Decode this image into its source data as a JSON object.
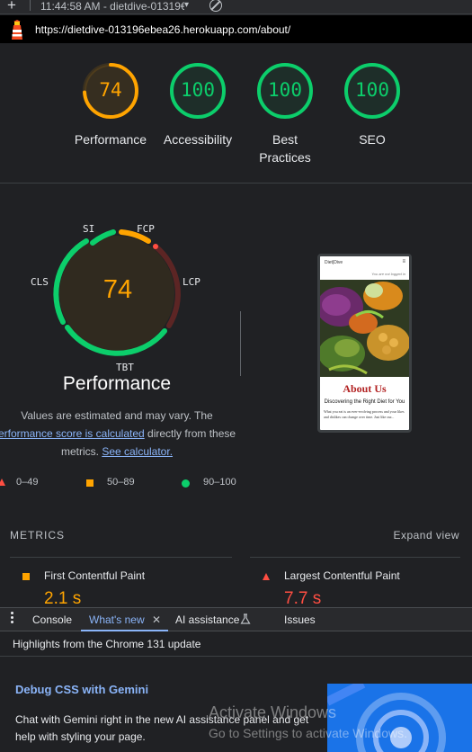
{
  "toolbar": {
    "time_text": "11:44:58 AM - dietdive-01319€",
    "dropdown_glyph": "▾",
    "plus_glyph": "+"
  },
  "urlbar": {
    "url": "https://dietdive-013196ebea26.herokuapp.com/about/"
  },
  "scores": [
    {
      "label": "Performance",
      "value": "74",
      "color": "#ffa400",
      "fraction": 0.74
    },
    {
      "label": "Accessibility",
      "value": "100",
      "color": "#0cce6b",
      "fraction": 1.0
    },
    {
      "label": "Best Practices",
      "value": "100",
      "color": "#0cce6b",
      "fraction": 1.0
    },
    {
      "label": "SEO",
      "value": "100",
      "color": "#0cce6b",
      "fraction": 1.0
    }
  ],
  "performance": {
    "score": "74",
    "title": "Performance",
    "metric_labels": {
      "si": "SI",
      "fcp": "FCP",
      "lcp": "LCP",
      "tbt": "TBT",
      "cls": "CLS"
    },
    "note_line1": "Values are estimated and may vary. The",
    "note_link1": "erformance score is calculated",
    "note_line2_rest": " directly from these",
    "note_line3_pre": "metrics. ",
    "note_link2": "See calculator."
  },
  "legend": {
    "fail": "0–49",
    "average": "50–89",
    "pass": "90–100"
  },
  "phone_preview": {
    "brand": "Diet|Dive",
    "menu_glyph": "≡",
    "tagline": "You are not logged in",
    "heading": "About Us",
    "subheading": "Discovering the Right Diet for You",
    "body": "What you eat is an ever-evolving process and your likes and dislikes can change over time. Just like our..."
  },
  "metrics": {
    "header": "METRICS",
    "expand": "Expand view",
    "items": [
      {
        "label": "First Contentful Paint",
        "value": "2.1 s",
        "status": "average",
        "color": "#ffa400"
      },
      {
        "label": "Largest Contentful Paint",
        "value": "7.7 s",
        "status": "fail",
        "color": "#ff4e42"
      }
    ]
  },
  "drawer": {
    "tabs": [
      {
        "label": "Console",
        "active": false
      },
      {
        "label": "What's new",
        "active": true
      },
      {
        "label": "AI assistance",
        "active": false
      },
      {
        "label": "Issues",
        "active": false
      }
    ],
    "close_glyph": "✕",
    "highlights": "Highlights from the Chrome 131 update",
    "feature_title": "Debug CSS with Gemini",
    "feature_text": "Chat with Gemini right in the new AI assistance panel and get help with styling your page."
  },
  "watermark": {
    "line1": "Activate Windows",
    "line2": "Go to Settings to activate Windows."
  },
  "colors": {
    "accent_blue": "#8ab4f8",
    "average": "#ffa400",
    "pass": "#0cce6b",
    "fail": "#ff4e42"
  }
}
